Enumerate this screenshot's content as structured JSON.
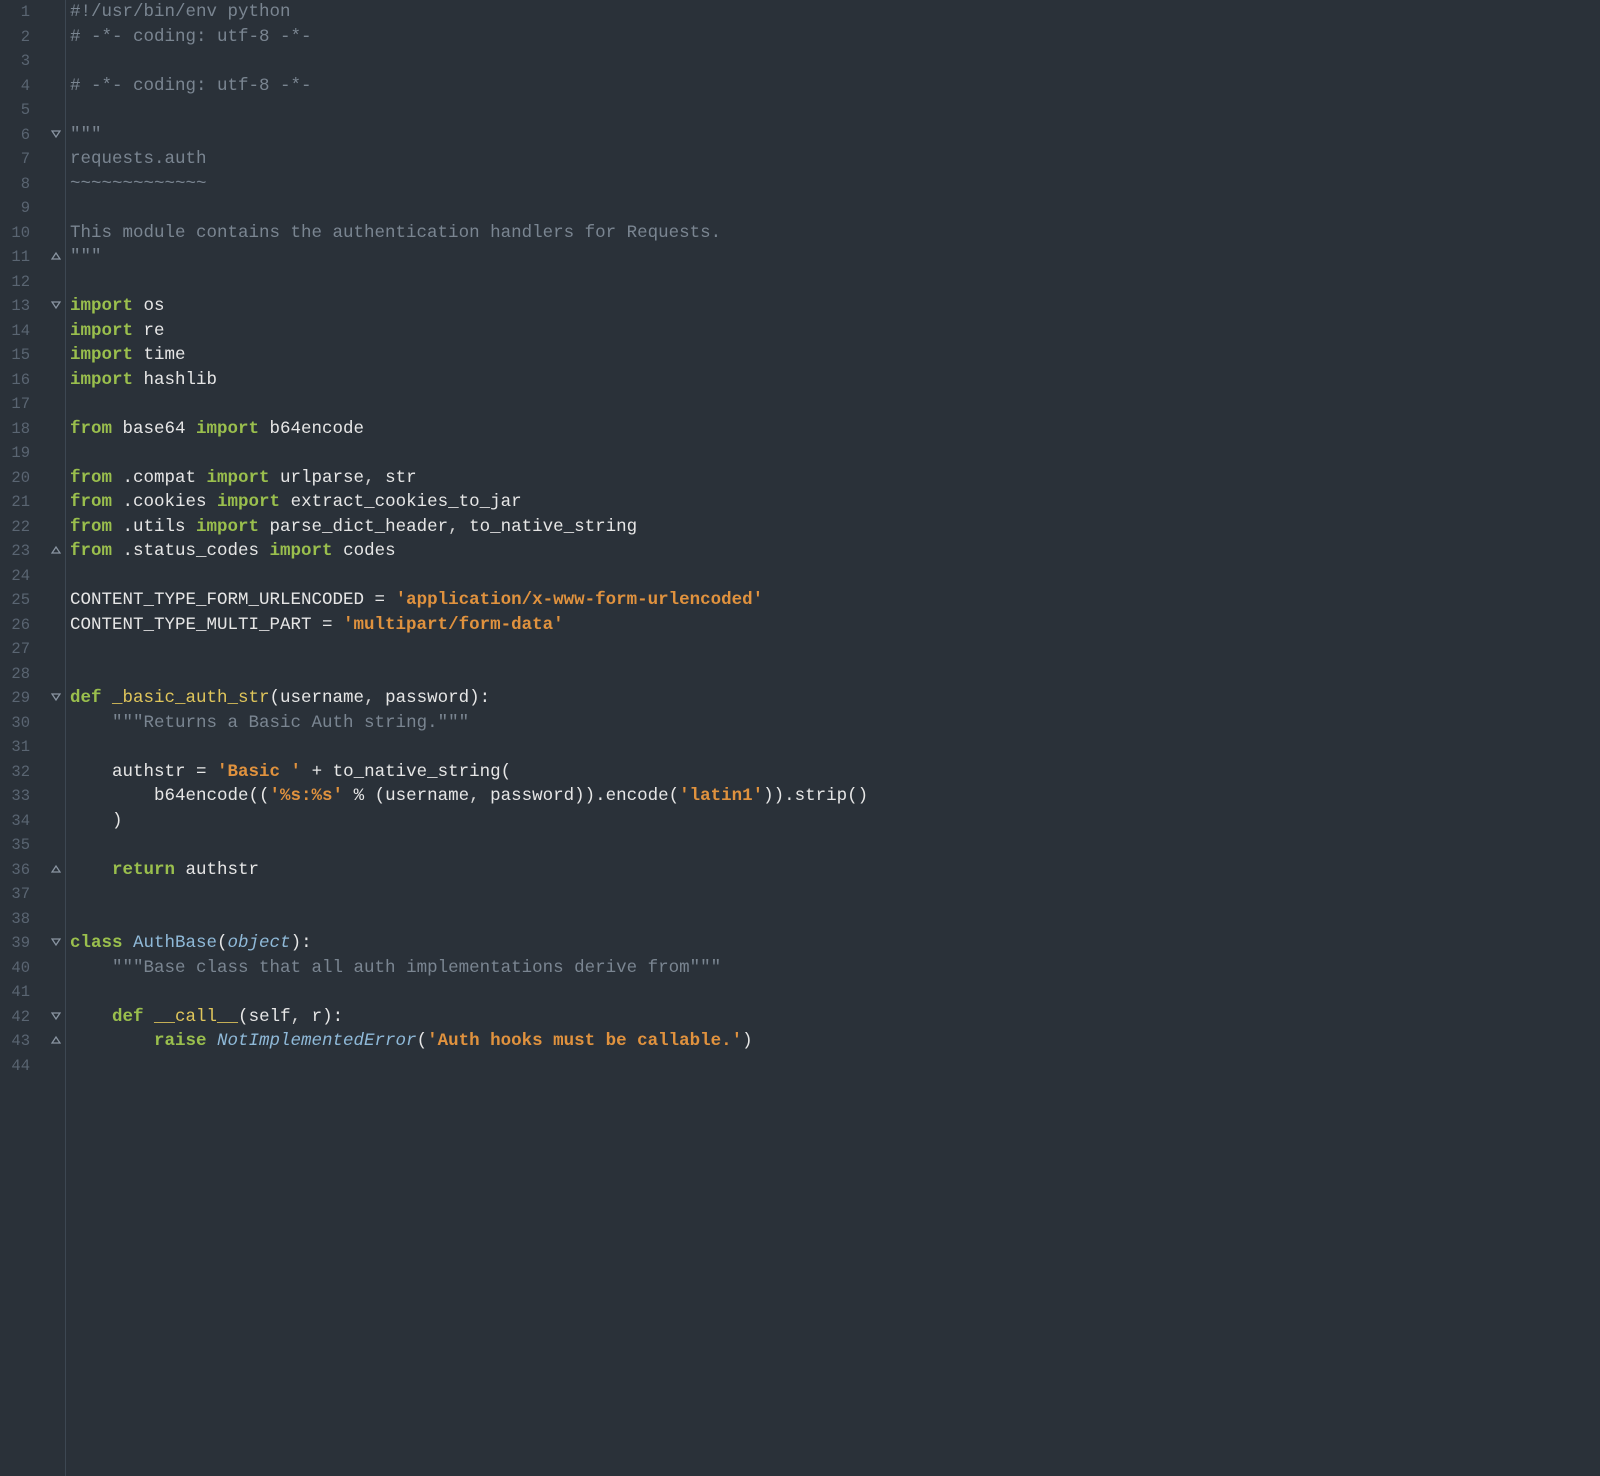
{
  "lineCount": 44,
  "lines": [
    {
      "n": 1,
      "tokens": [
        {
          "t": "#!/usr/bin/env python",
          "c": "c-comment"
        }
      ]
    },
    {
      "n": 2,
      "tokens": [
        {
          "t": "# -*- coding: utf-8 -*-",
          "c": "c-comment"
        }
      ]
    },
    {
      "n": 3,
      "tokens": []
    },
    {
      "n": 4,
      "tokens": [
        {
          "t": "# -*- coding: utf-8 -*-",
          "c": "c-comment"
        }
      ]
    },
    {
      "n": 5,
      "tokens": []
    },
    {
      "n": 6,
      "fold": "open",
      "tokens": [
        {
          "t": "\"\"\"",
          "c": "c-comment"
        }
      ]
    },
    {
      "n": 7,
      "tokens": [
        {
          "t": "requests.auth",
          "c": "c-comment"
        }
      ]
    },
    {
      "n": 8,
      "tokens": [
        {
          "t": "~~~~~~~~~~~~~",
          "c": "c-comment"
        }
      ]
    },
    {
      "n": 9,
      "tokens": []
    },
    {
      "n": 10,
      "tokens": [
        {
          "t": "This module contains the authentication handlers for Requests.",
          "c": "c-comment"
        }
      ]
    },
    {
      "n": 11,
      "fold": "close",
      "tokens": [
        {
          "t": "\"\"\"",
          "c": "c-comment"
        }
      ]
    },
    {
      "n": 12,
      "tokens": []
    },
    {
      "n": 13,
      "fold": "open",
      "tokens": [
        {
          "t": "import",
          "c": "c-keyword"
        },
        {
          "t": " os",
          "c": "c-def"
        }
      ]
    },
    {
      "n": 14,
      "tokens": [
        {
          "t": "import",
          "c": "c-keyword"
        },
        {
          "t": " re",
          "c": "c-def"
        }
      ]
    },
    {
      "n": 15,
      "tokens": [
        {
          "t": "import",
          "c": "c-keyword"
        },
        {
          "t": " time",
          "c": "c-def"
        }
      ]
    },
    {
      "n": 16,
      "tokens": [
        {
          "t": "import",
          "c": "c-keyword"
        },
        {
          "t": " hashlib",
          "c": "c-def"
        }
      ]
    },
    {
      "n": 17,
      "tokens": []
    },
    {
      "n": 18,
      "tokens": [
        {
          "t": "from",
          "c": "c-keyword"
        },
        {
          "t": " base64 ",
          "c": "c-def"
        },
        {
          "t": "import",
          "c": "c-keyword"
        },
        {
          "t": " b64encode",
          "c": "c-def"
        }
      ]
    },
    {
      "n": 19,
      "tokens": []
    },
    {
      "n": 20,
      "tokens": [
        {
          "t": "from",
          "c": "c-keyword"
        },
        {
          "t": " .compat ",
          "c": "c-def"
        },
        {
          "t": "import",
          "c": "c-keyword"
        },
        {
          "t": " urlparse",
          "c": "c-def"
        },
        {
          "t": ", ",
          "c": "c-op"
        },
        {
          "t": "str",
          "c": "c-def"
        }
      ]
    },
    {
      "n": 21,
      "tokens": [
        {
          "t": "from",
          "c": "c-keyword"
        },
        {
          "t": " .cookies ",
          "c": "c-def"
        },
        {
          "t": "import",
          "c": "c-keyword"
        },
        {
          "t": " extract_cookies_to_jar",
          "c": "c-def"
        }
      ]
    },
    {
      "n": 22,
      "tokens": [
        {
          "t": "from",
          "c": "c-keyword"
        },
        {
          "t": " .utils ",
          "c": "c-def"
        },
        {
          "t": "import",
          "c": "c-keyword"
        },
        {
          "t": " parse_dict_header",
          "c": "c-def"
        },
        {
          "t": ", ",
          "c": "c-op"
        },
        {
          "t": "to_native_string",
          "c": "c-def"
        }
      ]
    },
    {
      "n": 23,
      "fold": "close",
      "tokens": [
        {
          "t": "from",
          "c": "c-keyword"
        },
        {
          "t": " .status_codes ",
          "c": "c-def"
        },
        {
          "t": "import",
          "c": "c-keyword"
        },
        {
          "t": " codes",
          "c": "c-def"
        }
      ]
    },
    {
      "n": 24,
      "tokens": []
    },
    {
      "n": 25,
      "tokens": [
        {
          "t": "CONTENT_TYPE_FORM_URLENCODED = ",
          "c": "c-def"
        },
        {
          "t": "'application/x-www-form-urlencoded'",
          "c": "c-string"
        }
      ]
    },
    {
      "n": 26,
      "tokens": [
        {
          "t": "CONTENT_TYPE_MULTI_PART = ",
          "c": "c-def"
        },
        {
          "t": "'multipart/form-data'",
          "c": "c-string"
        }
      ]
    },
    {
      "n": 27,
      "tokens": []
    },
    {
      "n": 28,
      "tokens": []
    },
    {
      "n": 29,
      "fold": "open",
      "tokens": [
        {
          "t": "def ",
          "c": "c-keyword"
        },
        {
          "t": "_basic_auth_str",
          "c": "c-funcname"
        },
        {
          "t": "(username",
          "c": "c-def"
        },
        {
          "t": ", ",
          "c": "c-op"
        },
        {
          "t": "password):",
          "c": "c-def"
        }
      ]
    },
    {
      "n": 30,
      "indent": 1,
      "tokens": [
        {
          "t": "\"\"\"Returns a Basic Auth string.\"\"\"",
          "c": "c-comment"
        }
      ]
    },
    {
      "n": 31,
      "tokens": []
    },
    {
      "n": 32,
      "indent": 1,
      "tokens": [
        {
          "t": "authstr = ",
          "c": "c-def"
        },
        {
          "t": "'Basic '",
          "c": "c-string"
        },
        {
          "t": " + to_native_string(",
          "c": "c-def"
        }
      ]
    },
    {
      "n": 33,
      "indent": 2,
      "tokens": [
        {
          "t": "b64encode((",
          "c": "c-def"
        },
        {
          "t": "'%s:%s'",
          "c": "c-string"
        },
        {
          "t": " % (username",
          "c": "c-def"
        },
        {
          "t": ", ",
          "c": "c-op"
        },
        {
          "t": "password)).encode(",
          "c": "c-def"
        },
        {
          "t": "'latin1'",
          "c": "c-string"
        },
        {
          "t": ")).strip()",
          "c": "c-def"
        }
      ]
    },
    {
      "n": 34,
      "indent": 1,
      "tokens": [
        {
          "t": ")",
          "c": "c-def"
        }
      ]
    },
    {
      "n": 35,
      "tokens": []
    },
    {
      "n": 36,
      "fold": "close",
      "indent": 1,
      "tokens": [
        {
          "t": "return",
          "c": "c-keyword"
        },
        {
          "t": " authstr",
          "c": "c-def"
        }
      ]
    },
    {
      "n": 37,
      "tokens": []
    },
    {
      "n": 38,
      "tokens": []
    },
    {
      "n": 39,
      "fold": "open",
      "tokens": [
        {
          "t": "class ",
          "c": "c-keyword"
        },
        {
          "t": "AuthBase",
          "c": "c-classname"
        },
        {
          "t": "(",
          "c": "c-def"
        },
        {
          "t": "object",
          "c": "c-builtin"
        },
        {
          "t": "):",
          "c": "c-def"
        }
      ]
    },
    {
      "n": 40,
      "indent": 1,
      "tokens": [
        {
          "t": "\"\"\"Base class that all auth implementations derive from\"\"\"",
          "c": "c-comment"
        }
      ]
    },
    {
      "n": 41,
      "tokens": []
    },
    {
      "n": 42,
      "fold": "open",
      "indent": 1,
      "tokens": [
        {
          "t": "def ",
          "c": "c-keyword"
        },
        {
          "t": "__call__",
          "c": "c-funcname"
        },
        {
          "t": "(",
          "c": "c-def"
        },
        {
          "t": "self",
          "c": "c-def"
        },
        {
          "t": ", ",
          "c": "c-op"
        },
        {
          "t": "r):",
          "c": "c-def"
        }
      ]
    },
    {
      "n": 43,
      "fold": "close",
      "indent": 2,
      "tokens": [
        {
          "t": "raise ",
          "c": "c-keyword"
        },
        {
          "t": "NotImplementedError",
          "c": "c-err"
        },
        {
          "t": "(",
          "c": "c-def"
        },
        {
          "t": "'Auth hooks must be callable.'",
          "c": "c-string"
        },
        {
          "t": ")",
          "c": "c-def"
        }
      ]
    },
    {
      "n": 44,
      "tokens": []
    }
  ]
}
